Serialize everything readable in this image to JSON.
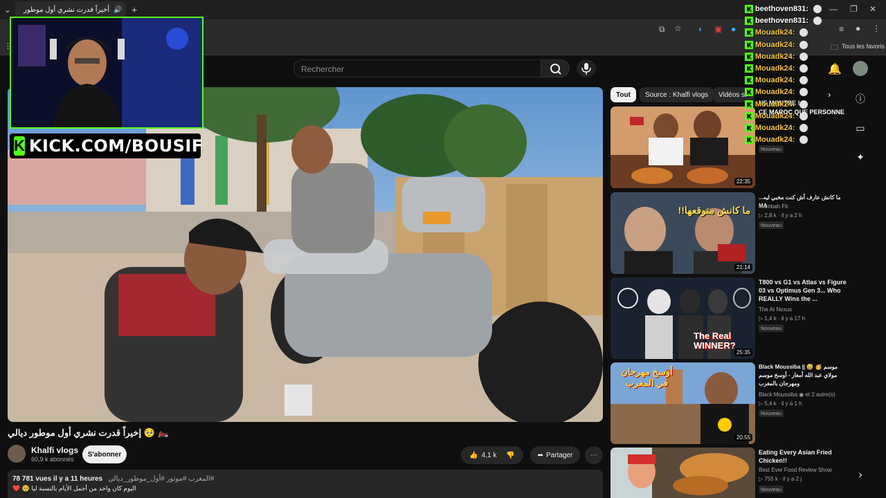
{
  "browser": {
    "tab_title": "أخيراً قدرت نشري أول موطور",
    "bookmarks_label": "Tous les favoris"
  },
  "header": {
    "search_placeholder": "Rechercher"
  },
  "overlay": {
    "kick_url": "KICK.COM/BOUSIF",
    "kick_icon": "K"
  },
  "chat": [
    {
      "user": "beethoven831:",
      "color": "#ffffff"
    },
    {
      "user": "beethoven831:",
      "color": "#ffffff"
    },
    {
      "user": "Mouadk24:",
      "color": "#f5c542"
    },
    {
      "user": "Mouadk24:",
      "color": "#f5c542"
    },
    {
      "user": "Mouadk24:",
      "color": "#f5c542"
    },
    {
      "user": "Mouadk24:",
      "color": "#f5c542"
    },
    {
      "user": "Mouadk24:",
      "color": "#f5c542"
    },
    {
      "user": "Mouadk24:",
      "color": "#f5c542"
    },
    {
      "user": "Mouadk24:",
      "color": "#f5c542"
    },
    {
      "user": "Mouadk24:",
      "color": "#f5c542"
    },
    {
      "user": "Mouadk24:",
      "color": "#f5c542"
    },
    {
      "user": "Mouadk24:",
      "color": "#f5c542"
    }
  ],
  "chat_overlay_texts": {
    "ne_montre": "NE MONTRE !",
    "ce_maroc": "CE MAROC QUE PERSONNE"
  },
  "video": {
    "title": "🏍️ 🥺 إخيراً قدرت نشري أول موطور ديالي",
    "channel": "Khalfi vlogs",
    "subs": "60,9 k abonnés",
    "subscribe": "S'abonner",
    "likes": "4,1 k",
    "share": "Partager",
    "desc_stats": "78 781 vues  il y a 11 heures",
    "desc_tags": "#المغرب #موتور #أول_موطور_ديالي",
    "desc_line2": "اليوم كان واحد من أجمل الأيام بالنسبة ليا 🥺 ❤️"
  },
  "chips": [
    "Tout",
    "Source : Khalfi vlogs",
    "Vidéos si"
  ],
  "recs": [
    {
      "title": "CE MAROC QUE PERSONNE NE MONTRE !",
      "channel": "",
      "meta": "",
      "badge": "Nouveau",
      "duration": "22:35"
    },
    {
      "title": "ما كانش عارف أش كنت مخبي ليه... MA",
      "channel": "Mambah Fit",
      "meta": "▷ 2,8 k · il y a 2 h",
      "badge": "Nouveau",
      "duration": "21:14"
    },
    {
      "title": "T800 vs G1 vs Atlas vs Figure 03 vs Optimus Gen 3... Who REALLY Wins the ...",
      "channel": "The AI Nexus",
      "meta": "▷ 1,4 k · il y a 17 h",
      "badge": "Nouveau",
      "duration": "25:35"
    },
    {
      "title": "Black Moussiba || 😅 🥳 موسم مولاي عبد الله أمغار - أوسخ موسم ومهرجان بالمغرب",
      "channel": "Black Moussiba ◉ et 2 autre(s)",
      "meta": "▷ 5,4 k · il y a 1 h",
      "badge": "Nouveau",
      "duration": "20:55"
    },
    {
      "title": "Eating Every Asian Fried Chicken!!",
      "channel": "Best Ever Food Review Show",
      "meta": "▷ 755 k · il y a 2 j",
      "badge": "Nouveau",
      "duration": ""
    }
  ],
  "thumb_texts": {
    "rec2": "ما كانش متوقعها!!",
    "rec3": "The Real WINNER?",
    "rec4": "أوسخ مهرجان في المغرب"
  }
}
